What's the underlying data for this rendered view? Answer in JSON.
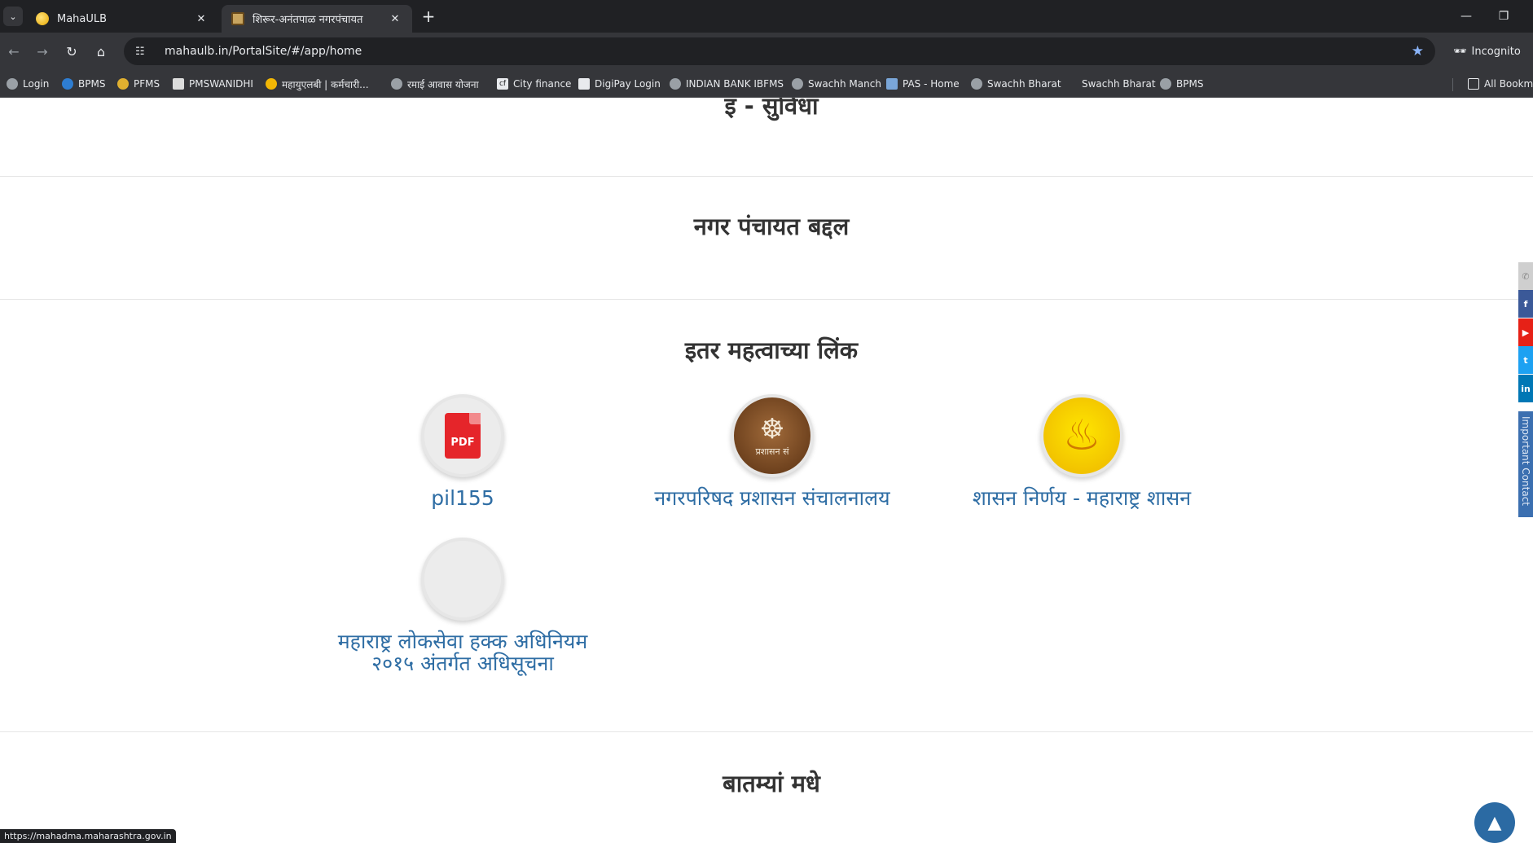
{
  "browser": {
    "tabs": [
      {
        "title": "MahaULB"
      },
      {
        "title": "शिरूर-अनंतपाळ नगरपंचायत"
      }
    ],
    "address": "mahaulb.in/PortalSite/#/app/home",
    "incognito_label": "Incognito",
    "bookmarks": [
      {
        "label": "Login",
        "icon": "globe-icon"
      },
      {
        "label": "BPMS",
        "icon": "globe-icon"
      },
      {
        "label": "PFMS",
        "icon": "emblem-icon"
      },
      {
        "label": "PMSWANIDHI",
        "icon": "pm-icon"
      },
      {
        "label": "महायुएलबी | कर्मचारी...",
        "icon": "coin-icon"
      },
      {
        "label": "रमाई आवास योजना",
        "icon": "globe-icon"
      },
      {
        "label": "City finance",
        "icon": "cf-icon"
      },
      {
        "label": "DigiPay Login",
        "icon": "digipay-icon"
      },
      {
        "label": "INDIAN BANK IBFMS",
        "icon": "globe-icon"
      },
      {
        "label": "Swachh Manch",
        "icon": "globe-icon"
      },
      {
        "label": "PAS - Home",
        "icon": "pas-icon"
      },
      {
        "label": "Swachh Bharat",
        "icon": "globe-icon"
      },
      {
        "label": "Swachh Bharat",
        "icon": "blank-icon"
      },
      {
        "label": "BPMS",
        "icon": "globe-icon"
      }
    ],
    "all_bookmarks": "All Bookma",
    "status_url": "https://mahadma.maharashtra.gov.in"
  },
  "page": {
    "sections": {
      "eservices": "इ - सुविधा",
      "about": "नगर पंचायत बद्दल",
      "links": "इतर महत्वाच्या लिंक",
      "news": "बातम्यां मधे"
    },
    "important_links": [
      {
        "label": "pil155",
        "icon": "pdf-icon",
        "icon_text": "PDF"
      },
      {
        "label": "नगरपरिषद प्रशासन संचालनालय",
        "icon": "state-emblem-icon",
        "icon_text": "प्रशासन सं"
      },
      {
        "label": "शासन निर्णय - महाराष्ट्र शासन",
        "icon": "lamp-icon"
      },
      {
        "label": "महाराष्ट्र लोकसेवा हक्क अधिनियम २०१५ अंतर्गत अधिसूचना",
        "icon": "blank-image-icon"
      }
    ],
    "side_contact_label": "Important Contact",
    "colors": {
      "link_blue": "#2e6da4",
      "heading": "#333333",
      "facebook": "#3b5998",
      "youtube": "#e62117",
      "twitter": "#1da1f2",
      "linkedin": "#0077b5"
    }
  }
}
